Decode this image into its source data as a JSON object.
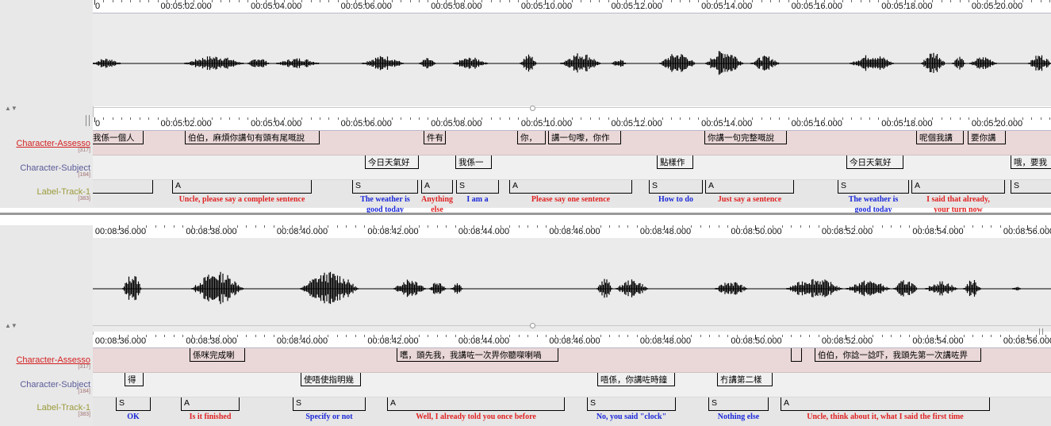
{
  "top": {
    "wave_ruler": {
      "start_sec": 300.0,
      "end_sec": 321.0,
      "ticks": [
        "0",
        "00:05:02.000",
        "00:05:04.000",
        "00:05:06.000",
        "00:05:08.000",
        "00:05:10.000",
        "00:05:12.000",
        "00:05:14.000",
        "00:05:16.000",
        "00:05:18.000",
        "00:05:20.000",
        "00:05:2"
      ]
    },
    "tier_ruler": {
      "ticks": [
        "0",
        "00:05:02.000",
        "00:05:04.000",
        "00:05:06.000",
        "00:05:08.000",
        "00:05:10.000",
        "00:05:12.000",
        "00:05:14.000",
        "00:05:16.000",
        "00:05:18.000",
        "00:05:20.000",
        "00:05:2"
      ]
    },
    "tiers": [
      {
        "name": "Character-Assesso",
        "count": "[317]",
        "color": "#dd2222"
      },
      {
        "name": "Character-Subject",
        "count": "[184]",
        "color": "#555599"
      },
      {
        "name": "Label-Track-1",
        "count": "[383]",
        "color": "#999944"
      }
    ],
    "assessor": [
      "我係一個人",
      "伯伯，麻煩你講句有頭有尾嘅說",
      "件有",
      "你，",
      "講一句嚟，你作",
      "你講一句完整嘅說",
      "呢個我講",
      "要你講"
    ],
    "subject": [
      "今日天氣好",
      "我係一",
      "點樣作",
      "今日天氣好",
      "哦，要我"
    ],
    "labels": [
      {
        "mark": "A",
        "text": "Uncle, please say a complete sentence"
      },
      {
        "mark": "S",
        "text": "The weather is\ngood today"
      },
      {
        "mark": "A",
        "text": "Anything\nelse"
      },
      {
        "mark": "S",
        "text": "I am a"
      },
      {
        "mark": "A",
        "text": "Please  say one sentence"
      },
      {
        "mark": "S",
        "text": "How to do"
      },
      {
        "mark": "A",
        "text": "Just say a sentence"
      },
      {
        "mark": "S",
        "text": "The weather is\ngood today"
      },
      {
        "mark": "A",
        "text": "I said that already,\nyour turn now"
      },
      {
        "mark": "S",
        "text": ""
      }
    ]
  },
  "bottom": {
    "wave_ruler": {
      "ticks": [
        "00:08:36.000",
        "00:08:38.000",
        "00:08:40.000",
        "00:08:42.000",
        "00:08:44.000",
        "00:08:46.000",
        "00:08:48.000",
        "00:08:50.000",
        "00:08:52.000",
        "00:08:54.000",
        "00:08:56.000"
      ]
    },
    "tier_ruler": {
      "ticks": [
        "00:08:36.000",
        "00:08:38.000",
        "00:08:40.000",
        "00:08:42.000",
        "00:08:44.000",
        "00:08:46.000",
        "00:08:48.000",
        "00:08:50.000",
        "00:08:52.000",
        "00:08:54.000",
        "00:08:56.000"
      ]
    },
    "tiers": [
      {
        "name": "Character-Assesso",
        "count": "[317]",
        "color": "#dd2222"
      },
      {
        "name": "Character-Subject",
        "count": "[184]",
        "color": "#555599"
      },
      {
        "name": "Label-Track-1",
        "count": "[383]",
        "color": "#999944"
      }
    ],
    "assessor": [
      "係咪完成喇",
      "嚿，頭先我，我講咗一次畀你聽㗎喇喎",
      "伯伯，你諗一諗吓，我頭先第一次講咗畀"
    ],
    "subject": [
      "得",
      "使唔使指明幾",
      "唔係，你講咗時鐘",
      "冇講第二樣"
    ],
    "labels": [
      {
        "mark": "S",
        "text": "OK"
      },
      {
        "mark": "A",
        "text": "Is it finished"
      },
      {
        "mark": "S",
        "text": "Specify or not"
      },
      {
        "mark": "A",
        "text": "Well, I already told you once before"
      },
      {
        "mark": "S",
        "text": "No, you said \"clock\""
      },
      {
        "mark": "S",
        "text": "Nothing else"
      },
      {
        "mark": "A",
        "text": "Uncle, think about it, what I said the first time"
      }
    ]
  },
  "colors": {
    "assessor_en": "#e02222",
    "subject_en": "#1a28d8",
    "assessor_lane": "#ead7d7",
    "subject_lane": "#f0f0f0",
    "label_lane": "#e6e6e6"
  }
}
